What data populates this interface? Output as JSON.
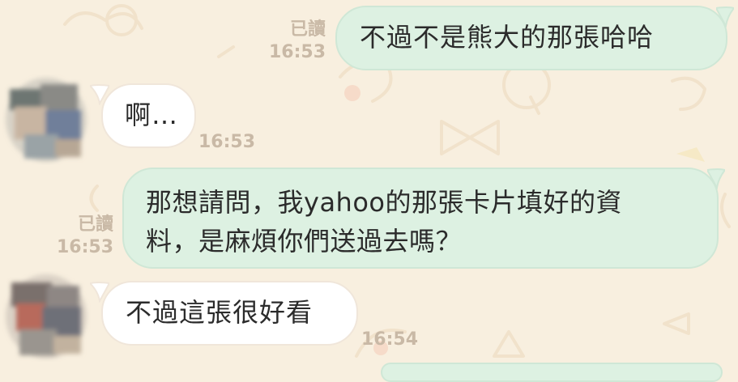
{
  "colors": {
    "background": "#f8efdf",
    "outgoing_bubble": "#ddf1e2",
    "incoming_bubble": "#ffffff",
    "meta_text": "#c9b9a6",
    "message_text": "#2b2b2b"
  },
  "messages": [
    {
      "direction": "outgoing",
      "text": "不過不是熊大的那張哈哈",
      "read_label": "已讀",
      "time": "16:53"
    },
    {
      "direction": "incoming",
      "avatar_icon": "blurred-avatar-icon",
      "text": "啊…",
      "time": "16:53"
    },
    {
      "direction": "outgoing",
      "text": "那想請問，我yahoo的那張卡片填好的資\n料，是麻煩你們送過去嗎？",
      "read_label": "已讀",
      "time": "16:53"
    },
    {
      "direction": "incoming",
      "avatar_icon": "blurred-avatar-icon",
      "text": "不過這張很好看",
      "time": "16:54"
    }
  ]
}
